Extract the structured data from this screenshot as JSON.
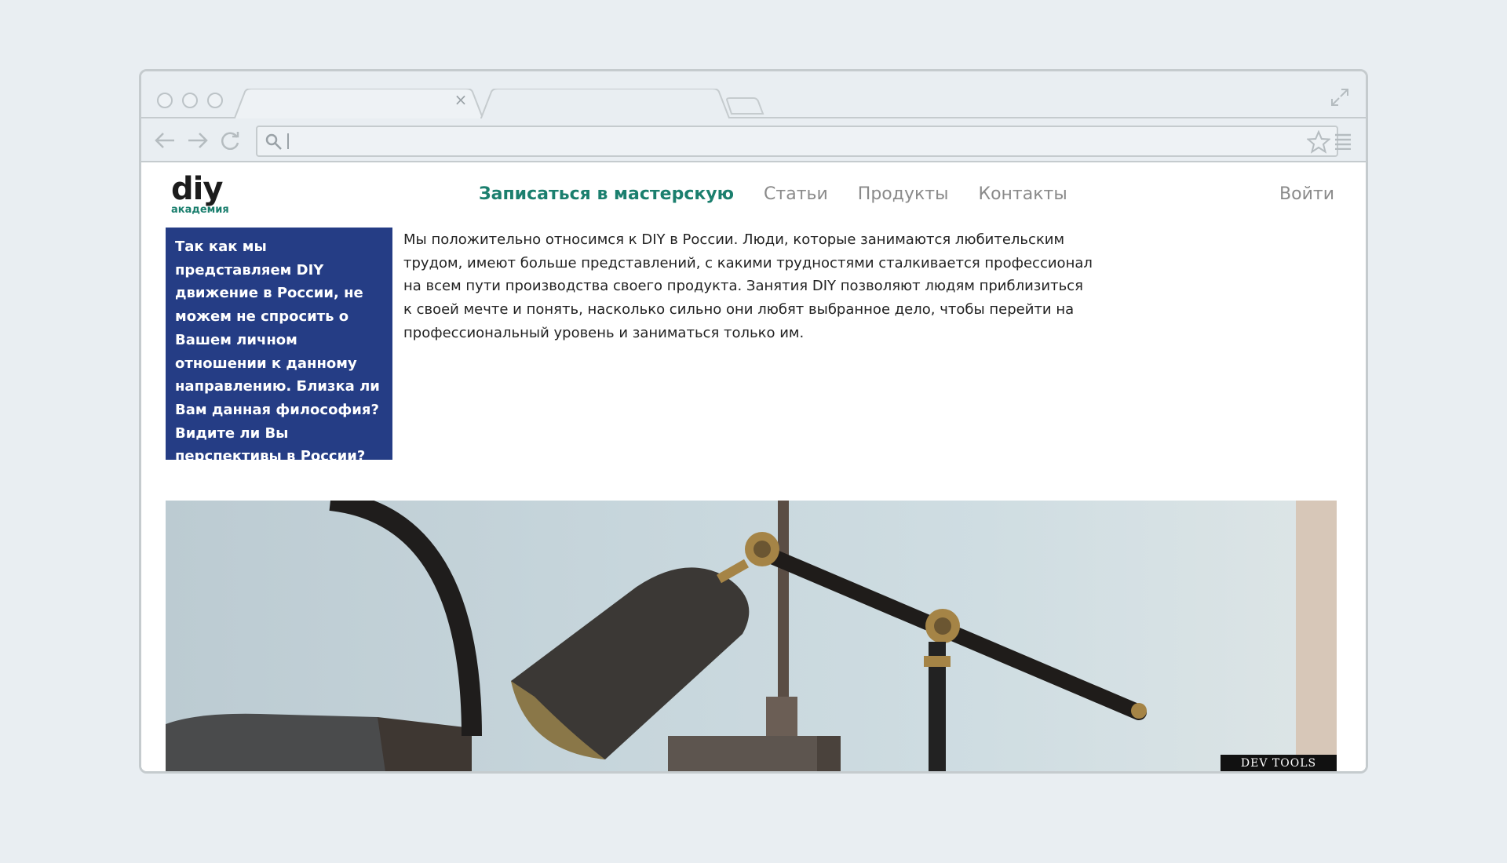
{
  "browser": {
    "tab_close_symbol": "×",
    "address_value": "",
    "icons": [
      "back-arrow-icon",
      "forward-arrow-icon",
      "reload-icon",
      "search-icon",
      "star-icon",
      "menu-icon",
      "expand-icon",
      "close-icon"
    ]
  },
  "site": {
    "logo_main": "diy",
    "logo_sub": "академия",
    "nav": {
      "items": [
        {
          "label": "Записаться в мастерскую",
          "active": true
        },
        {
          "label": "Статьи",
          "active": false
        },
        {
          "label": "Продукты",
          "active": false
        },
        {
          "label": "Контакты",
          "active": false
        }
      ]
    },
    "login_label": "Войти"
  },
  "content": {
    "question": "Так как мы представляем DIY движение в России, не можем не спросить о Вашем личном отношении к данному направлению. Близка ли Вам данная философия? Видите ли Вы перспективы в России?",
    "answer_lines": [
      "Мы положительно относимся к DIY в России. Люди, которые занимаются любительским",
      "трудом, имеют больше представлений, с какими трудностями сталкивается профессионал",
      "на всем пути производства своего продукта. Занятия DIY позволяют людям приблизиться",
      "к своей мечте и понять, насколько сильно они любят выбранное дело, чтобы перейти на",
      "профессиональный уровень и заниматься только им."
    ]
  },
  "devtools_label": "DEV TOOLS",
  "colors": {
    "accent": "#1b7f6e",
    "question_bg": "#253d85",
    "chrome_bg": "#e9eef2",
    "chrome_border": "#c5cbce"
  }
}
